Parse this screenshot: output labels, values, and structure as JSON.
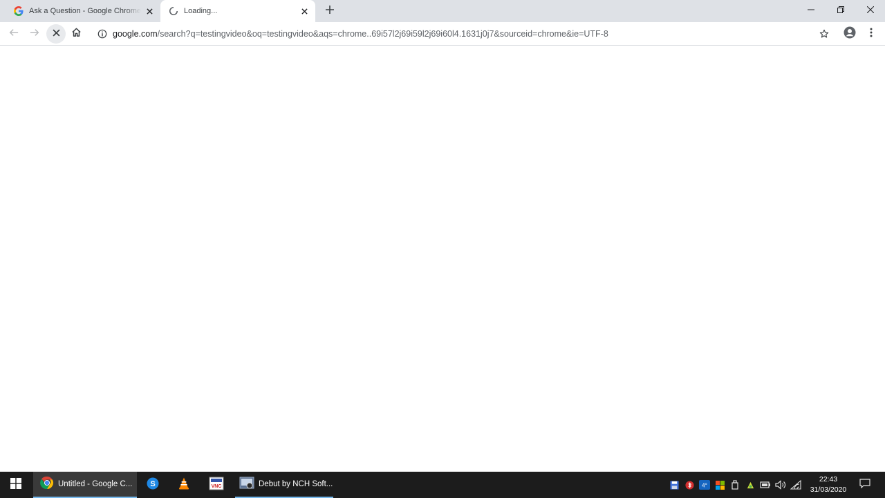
{
  "browser": {
    "tabs": [
      {
        "title": "Ask a Question - Google Chrome",
        "state": "inactive",
        "favicon": "google-g-icon"
      },
      {
        "title": "Loading...",
        "state": "active",
        "favicon": "loading-spinner-icon"
      }
    ],
    "new_tab_icon": "plus-icon",
    "window_controls": [
      "minimize-icon",
      "restore-icon",
      "close-icon"
    ]
  },
  "toolbar": {
    "back_icon": "arrow-left-icon",
    "forward_icon": "arrow-right-icon",
    "stop_icon": "stop-x-icon",
    "home_icon": "home-icon",
    "url_host": "google.com",
    "url_path": "/search?q=testingvideo&oq=testingvideo&aqs=chrome..69i57l2j69i59l2j69i60l4.1631j0j7&sourceid=chrome&ie=UTF-8",
    "bookmark_icon": "star-icon",
    "profile_icon": "account-circle-icon",
    "menu_icon": "three-dots-icon"
  },
  "taskbar": {
    "start_icon": "windows-logo-icon",
    "apps": [
      {
        "label": "Untitled - Google C...",
        "icon": "chrome-icon",
        "active": true
      },
      {
        "label": "",
        "icon": "skype-icon"
      },
      {
        "label": "",
        "icon": "vlc-icon"
      },
      {
        "label": "",
        "icon": "vnc-icon"
      },
      {
        "label": "Debut by NCH Soft...",
        "icon": "debut-icon",
        "active": false
      }
    ],
    "tray_icons": [
      "save-icon",
      "bluetooth-icon",
      "temperature-icon",
      "apps-tray-icon",
      "usb-icon",
      "network-app-icon",
      "battery-icon",
      "volume-icon",
      "wifi-icon"
    ],
    "tray_temp": "4°",
    "clock_time": "22:43",
    "clock_date": "31/03/2020",
    "notification_icon": "action-center-icon"
  },
  "colors": {
    "tabstrip": "#dee1e6",
    "taskbar": "#1c1c1c",
    "taskbar_accent": "#76b9ed"
  }
}
